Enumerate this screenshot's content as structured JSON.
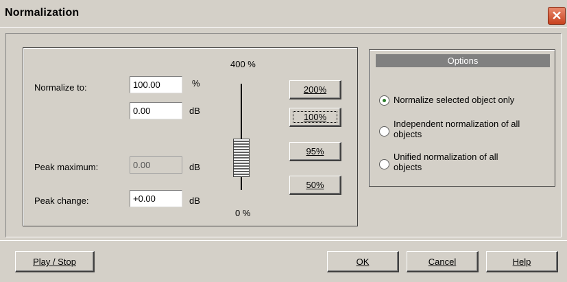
{
  "window": {
    "title": "Normalization",
    "close_glyph": "✕"
  },
  "normalize": {
    "normalize_to_label": "Normalize to:",
    "percent_value": "100.00",
    "percent_unit": "%",
    "db_value": "0.00",
    "db_unit": "dB",
    "peak_max_label": "Peak maximum:",
    "peak_max_value": "0.00",
    "peak_max_unit": "dB",
    "peak_change_label": "Peak change:",
    "peak_change_value": "+0.00",
    "peak_change_unit": "dB"
  },
  "slider": {
    "top_label": "400 %",
    "bottom_label": "0 %"
  },
  "presets": [
    "200%",
    "100%",
    "95%",
    "50%"
  ],
  "options": {
    "header": "Options",
    "items": [
      {
        "label_line1": "Normalize selected object only",
        "label_line2": "",
        "selected": true
      },
      {
        "label_line1": "Independent normalization of all",
        "label_line2": "objects",
        "selected": false
      },
      {
        "label_line1": "Unified normalization of all",
        "label_line2": "objects",
        "selected": false
      }
    ]
  },
  "footer": {
    "play_stop": "Play / Stop",
    "ok": "OK",
    "cancel": "Cancel",
    "help": "Help"
  }
}
